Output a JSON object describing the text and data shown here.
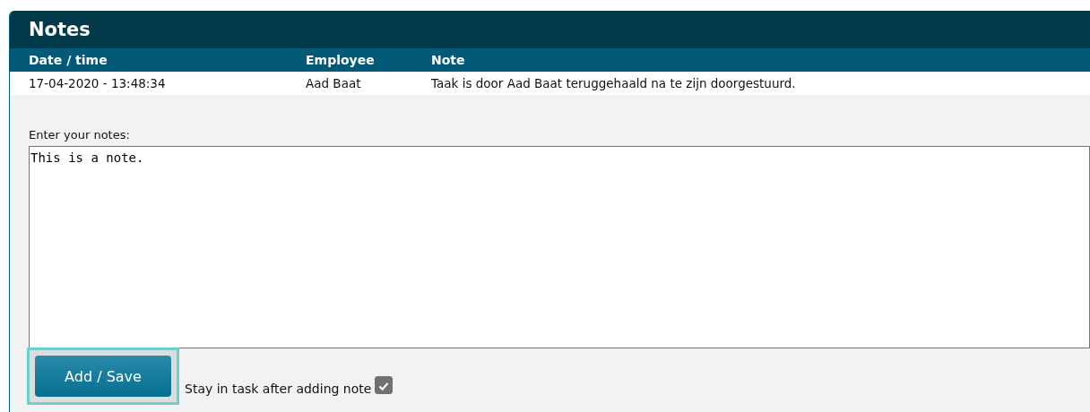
{
  "panel": {
    "title": "Notes"
  },
  "table": {
    "columns": [
      "Date / time",
      "Employee",
      "Note"
    ],
    "rows": [
      [
        "17-04-2020 - 13:48:34",
        "Aad Baat",
        "Taak is door Aad Baat teruggehaald na te zijn doorgestuurd."
      ]
    ]
  },
  "notes_field": {
    "label": "Enter your notes:",
    "value": "This is a note."
  },
  "add_button": {
    "label": "Add / Save",
    "focused": true
  },
  "stay_option": {
    "label": "Stay in task after adding note",
    "checked": true
  }
}
